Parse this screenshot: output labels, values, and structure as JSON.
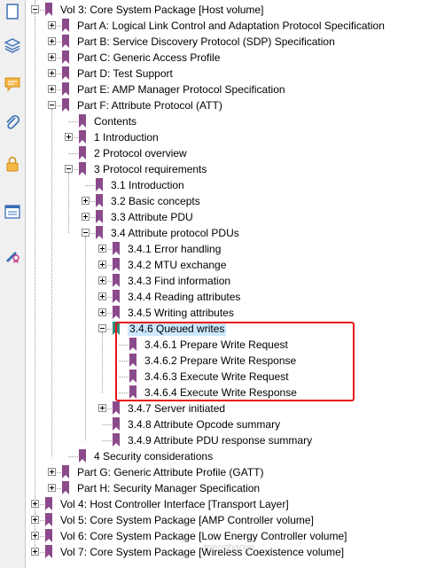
{
  "sidebar": {
    "icons": [
      "pages-icon",
      "layers-icon",
      "comment-icon",
      "attachment-icon",
      "lock-icon",
      "form-icon",
      "signature-icon"
    ]
  },
  "colors": {
    "bookmark": "#8b4a8b",
    "bookmark_selected": "#2e8b7a",
    "highlight": "#e8141b"
  },
  "tree": [
    {
      "label": "Vol 3: Core System Package [Host volume]",
      "level": 0,
      "exp": "minus"
    },
    {
      "label": "Part A: Logical Link Control and Adaptation Protocol Specification",
      "level": 1,
      "exp": "plus"
    },
    {
      "label": "Part B: Service Discovery Protocol (SDP) Specification",
      "level": 1,
      "exp": "plus"
    },
    {
      "label": "Part C: Generic Access Profile",
      "level": 1,
      "exp": "plus"
    },
    {
      "label": "Part D: Test Support",
      "level": 1,
      "exp": "plus"
    },
    {
      "label": "Part E: AMP Manager Protocol Specification",
      "level": 1,
      "exp": "plus"
    },
    {
      "label": "Part F: Attribute Protocol (ATT)",
      "level": 1,
      "exp": "minus"
    },
    {
      "label": "Contents",
      "level": 2,
      "exp": "none"
    },
    {
      "label": "1 Introduction",
      "level": 2,
      "exp": "plus"
    },
    {
      "label": "2 Protocol overview",
      "level": 2,
      "exp": "none"
    },
    {
      "label": "3 Protocol requirements",
      "level": 2,
      "exp": "minus"
    },
    {
      "label": "3.1 Introduction",
      "level": 3,
      "exp": "none"
    },
    {
      "label": "3.2 Basic concepts",
      "level": 3,
      "exp": "plus"
    },
    {
      "label": "3.3 Attribute PDU",
      "level": 3,
      "exp": "plus"
    },
    {
      "label": "3.4 Attribute protocol PDUs",
      "level": 3,
      "exp": "minus"
    },
    {
      "label": "3.4.1 Error handling",
      "level": 4,
      "exp": "plus"
    },
    {
      "label": "3.4.2 MTU exchange",
      "level": 4,
      "exp": "plus"
    },
    {
      "label": "3.4.3 Find information",
      "level": 4,
      "exp": "plus"
    },
    {
      "label": "3.4.4 Reading attributes",
      "level": 4,
      "exp": "plus"
    },
    {
      "label": "3.4.5 Writing attributes",
      "level": 4,
      "exp": "plus"
    },
    {
      "label": "3.4.6 Queued writes",
      "level": 4,
      "exp": "minus",
      "selected": true
    },
    {
      "label": "3.4.6.1 Prepare Write Request",
      "level": 5,
      "exp": "none"
    },
    {
      "label": "3.4.6.2 Prepare Write Response",
      "level": 5,
      "exp": "none"
    },
    {
      "label": "3.4.6.3 Execute Write Request",
      "level": 5,
      "exp": "none"
    },
    {
      "label": "3.4.6.4 Execute Write Response",
      "level": 5,
      "exp": "none"
    },
    {
      "label": "3.4.7 Server initiated",
      "level": 4,
      "exp": "plus"
    },
    {
      "label": "3.4.8 Attribute Opcode summary",
      "level": 4,
      "exp": "none"
    },
    {
      "label": "3.4.9 Attribute PDU response summary",
      "level": 4,
      "exp": "none"
    },
    {
      "label": "4 Security considerations",
      "level": 2,
      "exp": "none"
    },
    {
      "label": "Part G: Generic Attribute Profile (GATT)",
      "level": 1,
      "exp": "plus"
    },
    {
      "label": "Part H: Security Manager Specification",
      "level": 1,
      "exp": "plus"
    },
    {
      "label": "Vol 4: Host Controller Interface [Transport Layer]",
      "level": 0,
      "exp": "plus"
    },
    {
      "label": "Vol 5: Core System Package [AMP Controller volume]",
      "level": 0,
      "exp": "plus"
    },
    {
      "label": "Vol 6: Core System Package [Low Energy Controller volume]",
      "level": 0,
      "exp": "plus"
    },
    {
      "label": "Vol 7: Core System Package [Wireless Coexistence volume]",
      "level": 0,
      "exp": "plus"
    }
  ],
  "watermark": "menghaojin"
}
